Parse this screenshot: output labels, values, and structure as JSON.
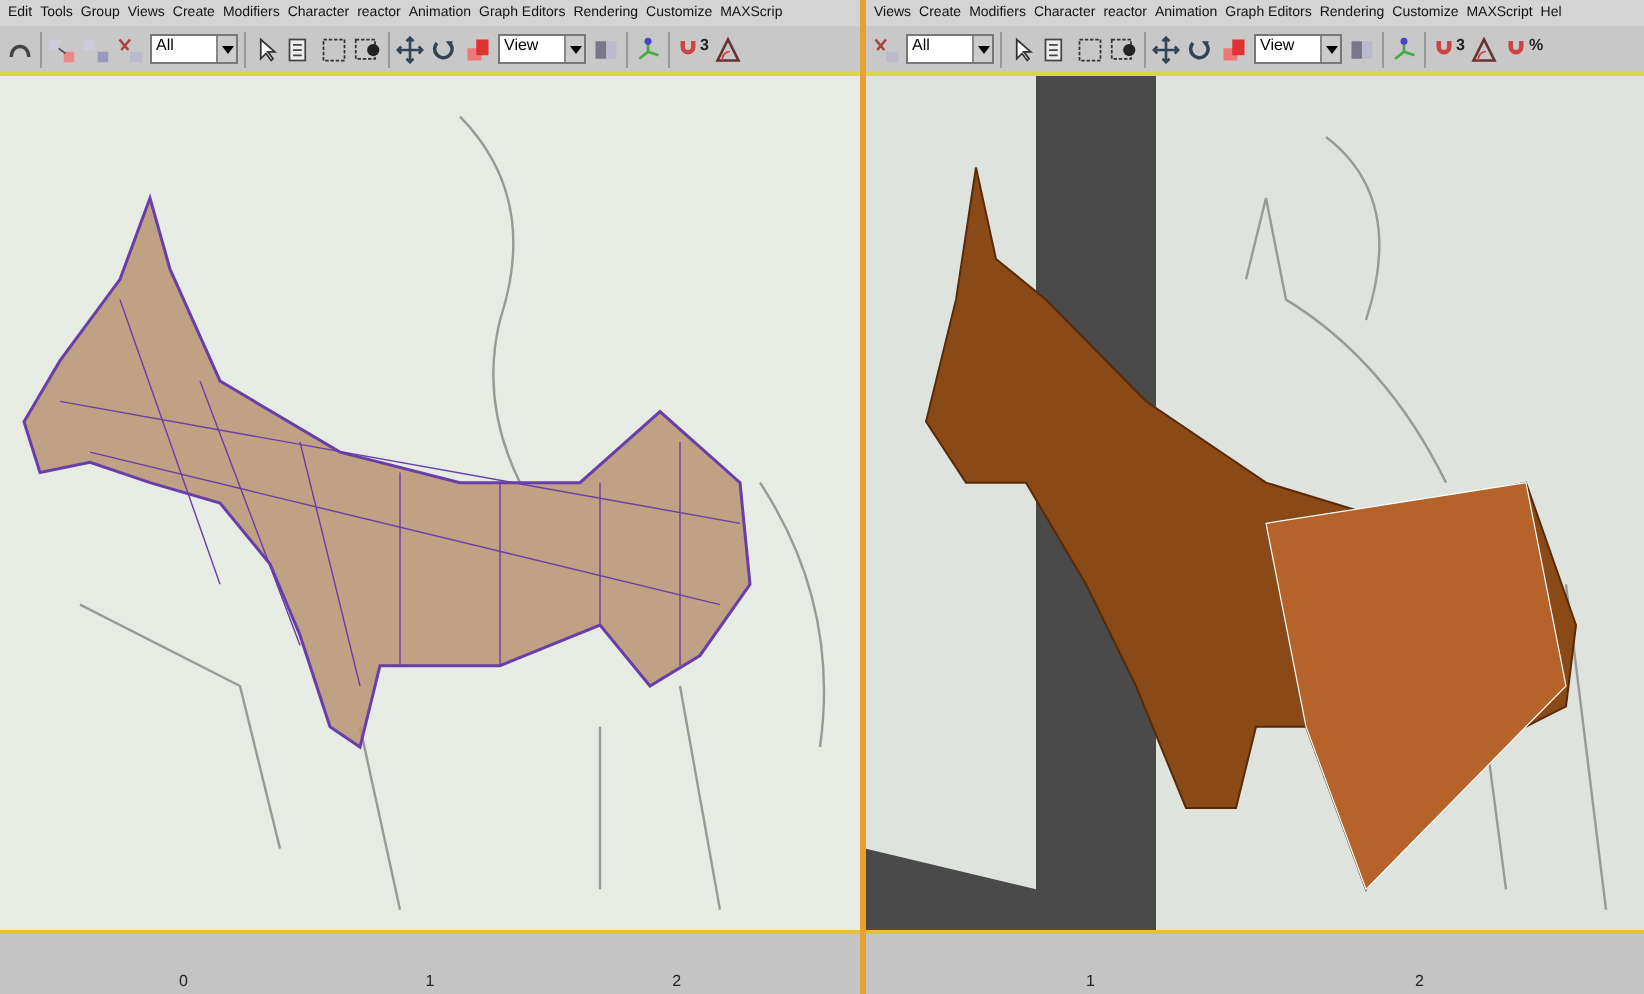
{
  "panes": [
    {
      "menu": [
        "Edit",
        "Tools",
        "Group",
        "Views",
        "Create",
        "Modifiers",
        "Character",
        "reactor",
        "Animation",
        "Graph Editors",
        "Rendering",
        "Customize",
        "MAXScrip"
      ],
      "toolbar": [
        {
          "kind": "undo"
        },
        {
          "kind": "sep"
        },
        {
          "kind": "link"
        },
        {
          "kind": "unlink"
        },
        {
          "kind": "bind"
        },
        {
          "kind": "dropdown",
          "value": "All"
        },
        {
          "kind": "sep"
        },
        {
          "kind": "select"
        },
        {
          "kind": "select-name"
        },
        {
          "kind": "rect"
        },
        {
          "kind": "window"
        },
        {
          "kind": "sep"
        },
        {
          "kind": "move"
        },
        {
          "kind": "rotate"
        },
        {
          "kind": "scale"
        },
        {
          "kind": "dropdown",
          "value": "View"
        },
        {
          "kind": "pivot"
        },
        {
          "kind": "sep"
        },
        {
          "kind": "axis"
        },
        {
          "kind": "sep"
        },
        {
          "kind": "snap",
          "value": "3"
        },
        {
          "kind": "angle"
        }
      ],
      "viewport": {
        "kind": "sketch"
      },
      "timeline": {
        "ticks": [
          "0",
          "1",
          "2"
        ]
      }
    },
    {
      "menu": [
        "Views",
        "Create",
        "Modifiers",
        "Character",
        "reactor",
        "Animation",
        "Graph Editors",
        "Rendering",
        "Customize",
        "MAXScript",
        "Hel"
      ],
      "toolbar": [
        {
          "kind": "bind"
        },
        {
          "kind": "dropdown",
          "value": "All"
        },
        {
          "kind": "sep"
        },
        {
          "kind": "select"
        },
        {
          "kind": "select-name"
        },
        {
          "kind": "rect"
        },
        {
          "kind": "window"
        },
        {
          "kind": "sep"
        },
        {
          "kind": "move"
        },
        {
          "kind": "rotate"
        },
        {
          "kind": "scale"
        },
        {
          "kind": "dropdown",
          "value": "View"
        },
        {
          "kind": "pivot"
        },
        {
          "kind": "sep"
        },
        {
          "kind": "axis"
        },
        {
          "kind": "sep"
        },
        {
          "kind": "snap",
          "value": "3"
        },
        {
          "kind": "angle"
        },
        {
          "kind": "snap",
          "value": "%"
        }
      ],
      "viewport": {
        "kind": "model"
      },
      "timeline": {
        "ticks": [
          "1",
          "2"
        ]
      }
    }
  ]
}
